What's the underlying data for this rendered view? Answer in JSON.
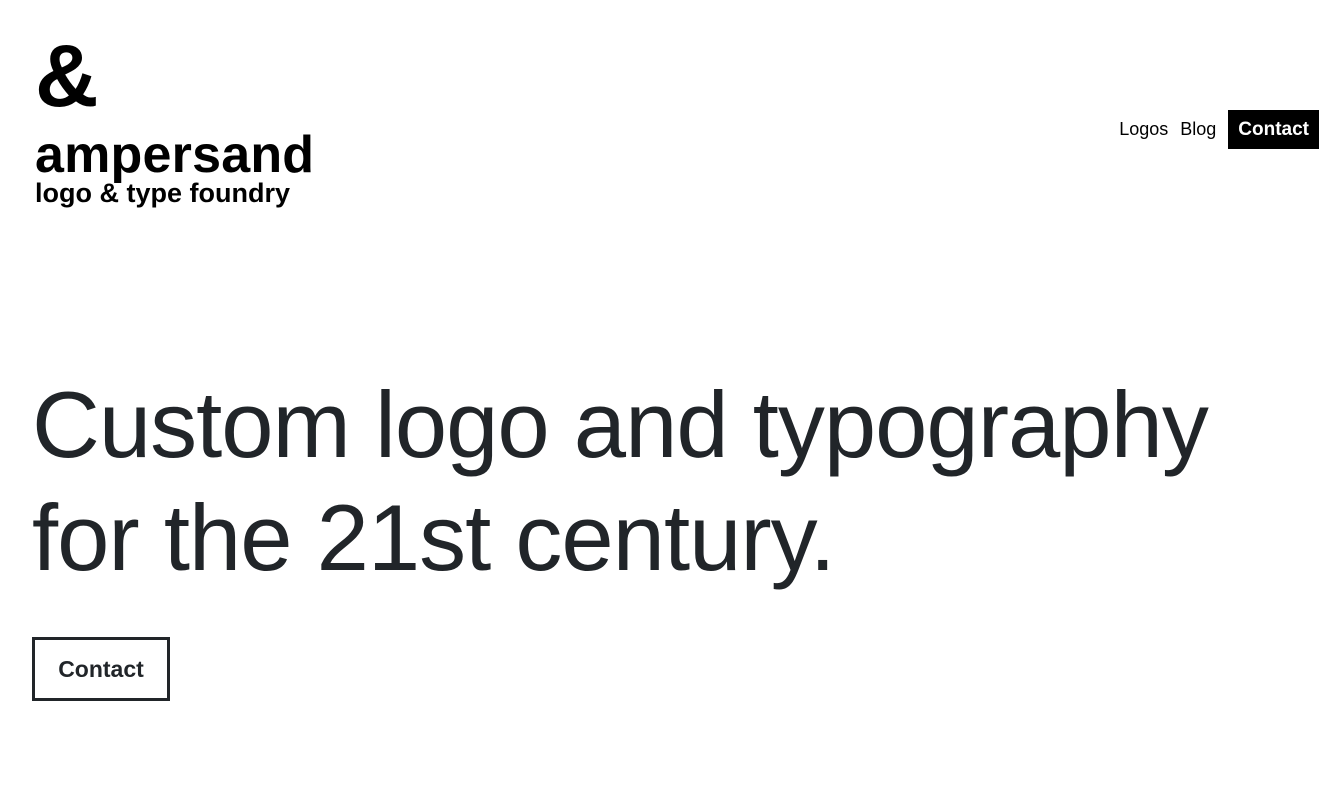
{
  "brand": {
    "mark": "&",
    "name": "ampersand",
    "tagline": "logo & type foundry"
  },
  "nav": {
    "items": [
      {
        "label": "Logos"
      },
      {
        "label": "Blog"
      }
    ],
    "contact_label": "Contact"
  },
  "hero": {
    "title_line1": "Custom logo and typography",
    "title_line2": "for the 21st century.",
    "cta_label": "Contact"
  },
  "colors": {
    "text_dark": "#212529",
    "black": "#000000",
    "background": "#ffffff"
  }
}
